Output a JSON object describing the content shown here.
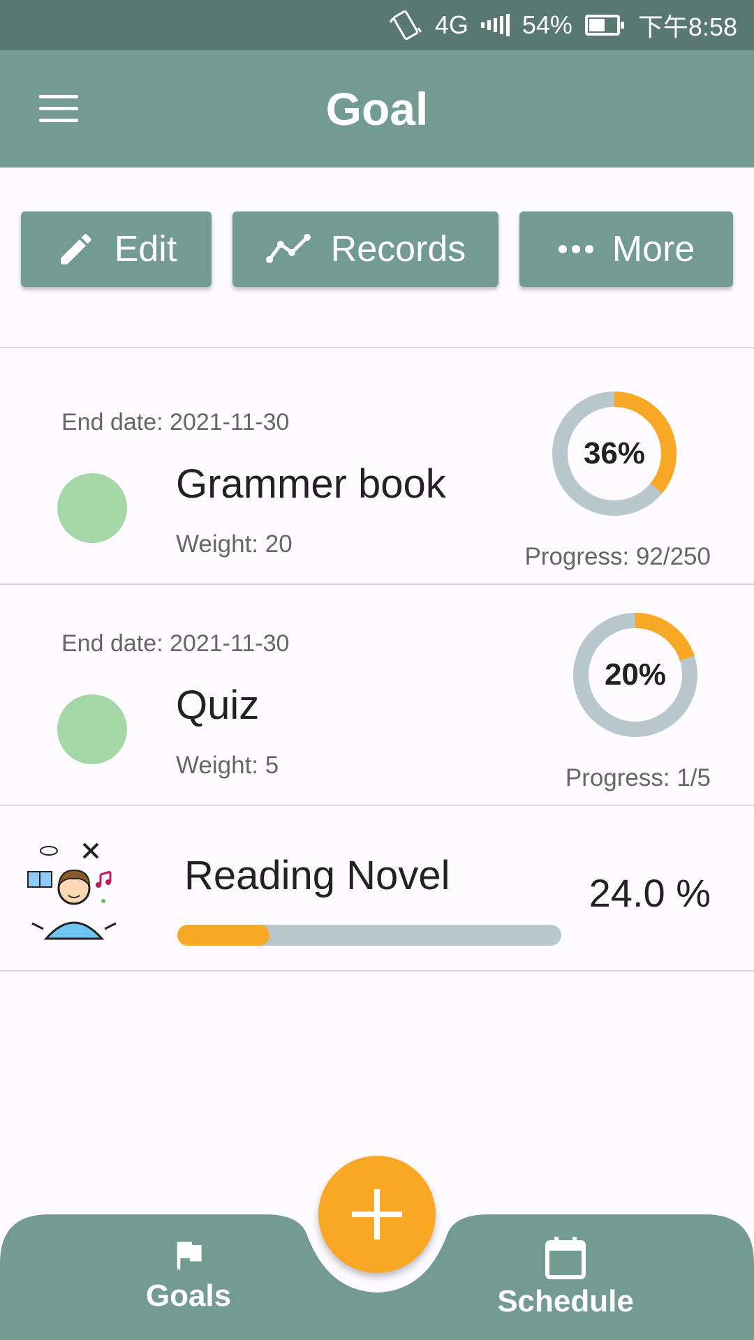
{
  "status_bar": {
    "network": "4G",
    "battery": "54%",
    "time": "下午8:58"
  },
  "app_bar": {
    "title": "Goal"
  },
  "actions": {
    "edit_label": "Edit",
    "records_label": "Records",
    "more_label": "More"
  },
  "goals": [
    {
      "end_date": "End date: 2021-11-30",
      "name": "Grammer book",
      "weight": "Weight: 20",
      "percent_label": "36%",
      "percent": 36,
      "progress": "Progress: 92/250",
      "dot_color": "#a5d6a7"
    },
    {
      "end_date": "End date: 2021-11-30",
      "name": "Quiz",
      "weight": "Weight: 5",
      "percent_label": "20%",
      "percent": 20,
      "progress": "Progress: 1/5",
      "dot_color": "#a5d6a7"
    }
  ],
  "reading": {
    "name": "Reading Novel",
    "percent_label": "24.0 %",
    "percent": 24
  },
  "bottom_nav": {
    "goals_label": "Goals",
    "schedule_label": "Schedule"
  },
  "colors": {
    "primary": "#749b92",
    "status_bar": "#587870",
    "accent": "#f9a825",
    "track": "#b7c7cc"
  }
}
